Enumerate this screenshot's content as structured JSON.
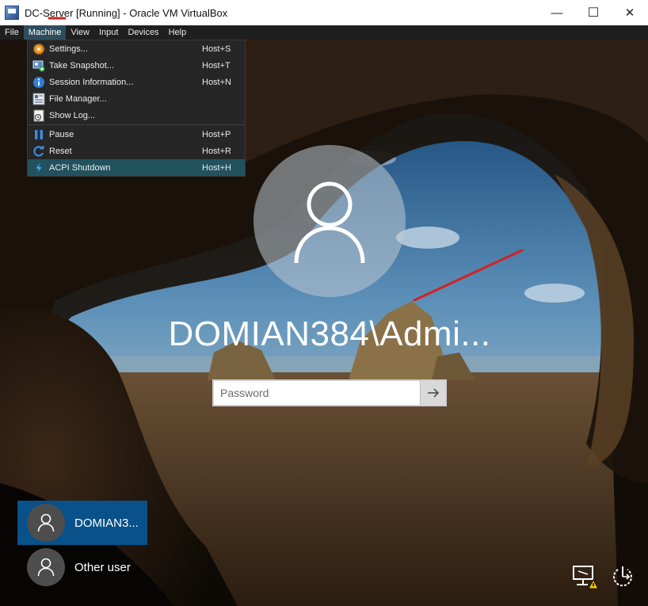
{
  "window": {
    "title": "DC-Server [Running] - Oracle VM VirtualBox",
    "minimize_glyph": "—",
    "maximize_glyph": "☐",
    "close_glyph": "✕"
  },
  "menubar": {
    "items": [
      {
        "label": "File"
      },
      {
        "label": "Machine"
      },
      {
        "label": "View"
      },
      {
        "label": "Input"
      },
      {
        "label": "Devices"
      },
      {
        "label": "Help"
      }
    ]
  },
  "machine_menu": {
    "items": [
      {
        "label": "Settings...",
        "shortcut": "Host+S",
        "icon": "gear-icon"
      },
      {
        "label": "Take Snapshot...",
        "shortcut": "Host+T",
        "icon": "snapshot-icon"
      },
      {
        "label": "Session Information...",
        "shortcut": "Host+N",
        "icon": "info-icon"
      },
      {
        "label": "File Manager...",
        "shortcut": "",
        "icon": "file-manager-icon"
      },
      {
        "label": "Show Log...",
        "shortcut": "",
        "icon": "log-icon"
      },
      {
        "label": "Pause",
        "shortcut": "Host+P",
        "icon": "pause-icon"
      },
      {
        "label": "Reset",
        "shortcut": "Host+R",
        "icon": "reset-icon"
      },
      {
        "label": "ACPI Shutdown",
        "shortcut": "Host+H",
        "icon": "acpi-shutdown-icon"
      }
    ]
  },
  "login": {
    "username": "DOMIAN384\\Admi...",
    "password_placeholder": "Password"
  },
  "user_tiles": [
    {
      "name": "DOMIAN3...",
      "selected": true
    },
    {
      "name": "Other user",
      "selected": false
    }
  ],
  "icons": {
    "network": "network-warning-icon",
    "power": "power-icon"
  },
  "colors": {
    "menu_highlight": "#21525d",
    "tile_selected": "#08518a",
    "annotation_red": "#d42020"
  }
}
